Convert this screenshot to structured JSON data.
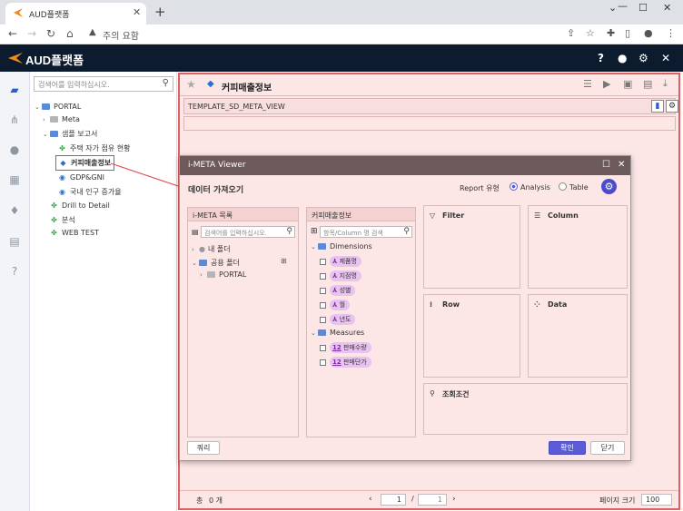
{
  "browser": {
    "tab_title": "AUD플랫폼",
    "url_text": "주의 요함"
  },
  "app": {
    "logo": "AUD플랫폼"
  },
  "tree": {
    "search_placeholder": "검색어를 입력하십시오.",
    "nodes": [
      "PORTAL",
      "Meta",
      "샘플 보고서",
      "주택 자가 점유 현황",
      "커피매출정보",
      "GDP&GNI",
      "국내 인구 증가율",
      "Drill to Detail",
      "분석",
      "WEB TEST"
    ]
  },
  "main": {
    "title": "커피매출정보",
    "template": "TEMPLATE_SD_META_VIEW",
    "total_label": "총",
    "total_count": "0 개",
    "page_current": "1",
    "page_sep": "/",
    "page_total": "1",
    "page_size_label": "페이지 크기",
    "page_size": "100"
  },
  "dialog": {
    "title": "i-META Viewer",
    "subtitle": "데이터 가져오기",
    "report_type_label": "Report 유형",
    "radio_analysis": "Analysis",
    "radio_table": "Table",
    "list_header": "i-META 목록",
    "list_search_placeholder": "검색어를 입력하십시오.",
    "list_items": [
      "내 폴더",
      "공용 폴더",
      "PORTAL"
    ],
    "fields_header": "커피매출정보",
    "fields_search_placeholder": "항목/Column 명 검색",
    "dimensions_label": "Dimensions",
    "dimensions": [
      "제품명",
      "지점명",
      "성별",
      "월",
      "년도"
    ],
    "measures_label": "Measures",
    "measures": [
      "판매수량",
      "판매단가"
    ],
    "zones": {
      "filter": "Filter",
      "column": "Column",
      "row": "Row",
      "data": "Data",
      "condition": "조회조건"
    },
    "query_button": "쿼리",
    "ok_button": "확인",
    "close_button": "닫기",
    "measure_icon": "12"
  },
  "colors": {
    "accent": "#5b5bd6",
    "folder": "#5b8bd8",
    "header": "#0d1b2e",
    "highlight": "#e04444"
  }
}
